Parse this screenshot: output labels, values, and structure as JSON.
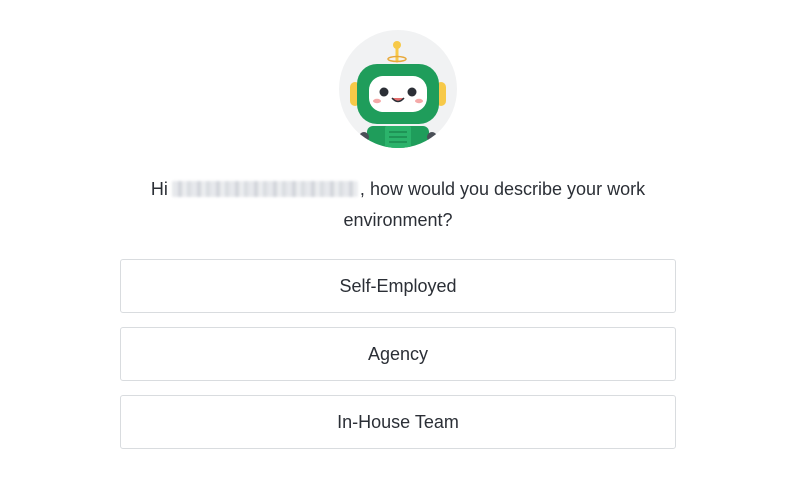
{
  "bot": {
    "icon": "robot-icon",
    "colors": {
      "body": "#1f9d5b",
      "face": "#ffffff",
      "ears": "#f7c948",
      "antenna": "#f7c948",
      "blush": "#f4a9a8",
      "background": "#f1f2f3"
    }
  },
  "question": {
    "greeting": "Hi",
    "text": "how would you describe your work environment?"
  },
  "options": [
    {
      "label": "Self-Employed"
    },
    {
      "label": "Agency"
    },
    {
      "label": "In-House Team"
    }
  ]
}
